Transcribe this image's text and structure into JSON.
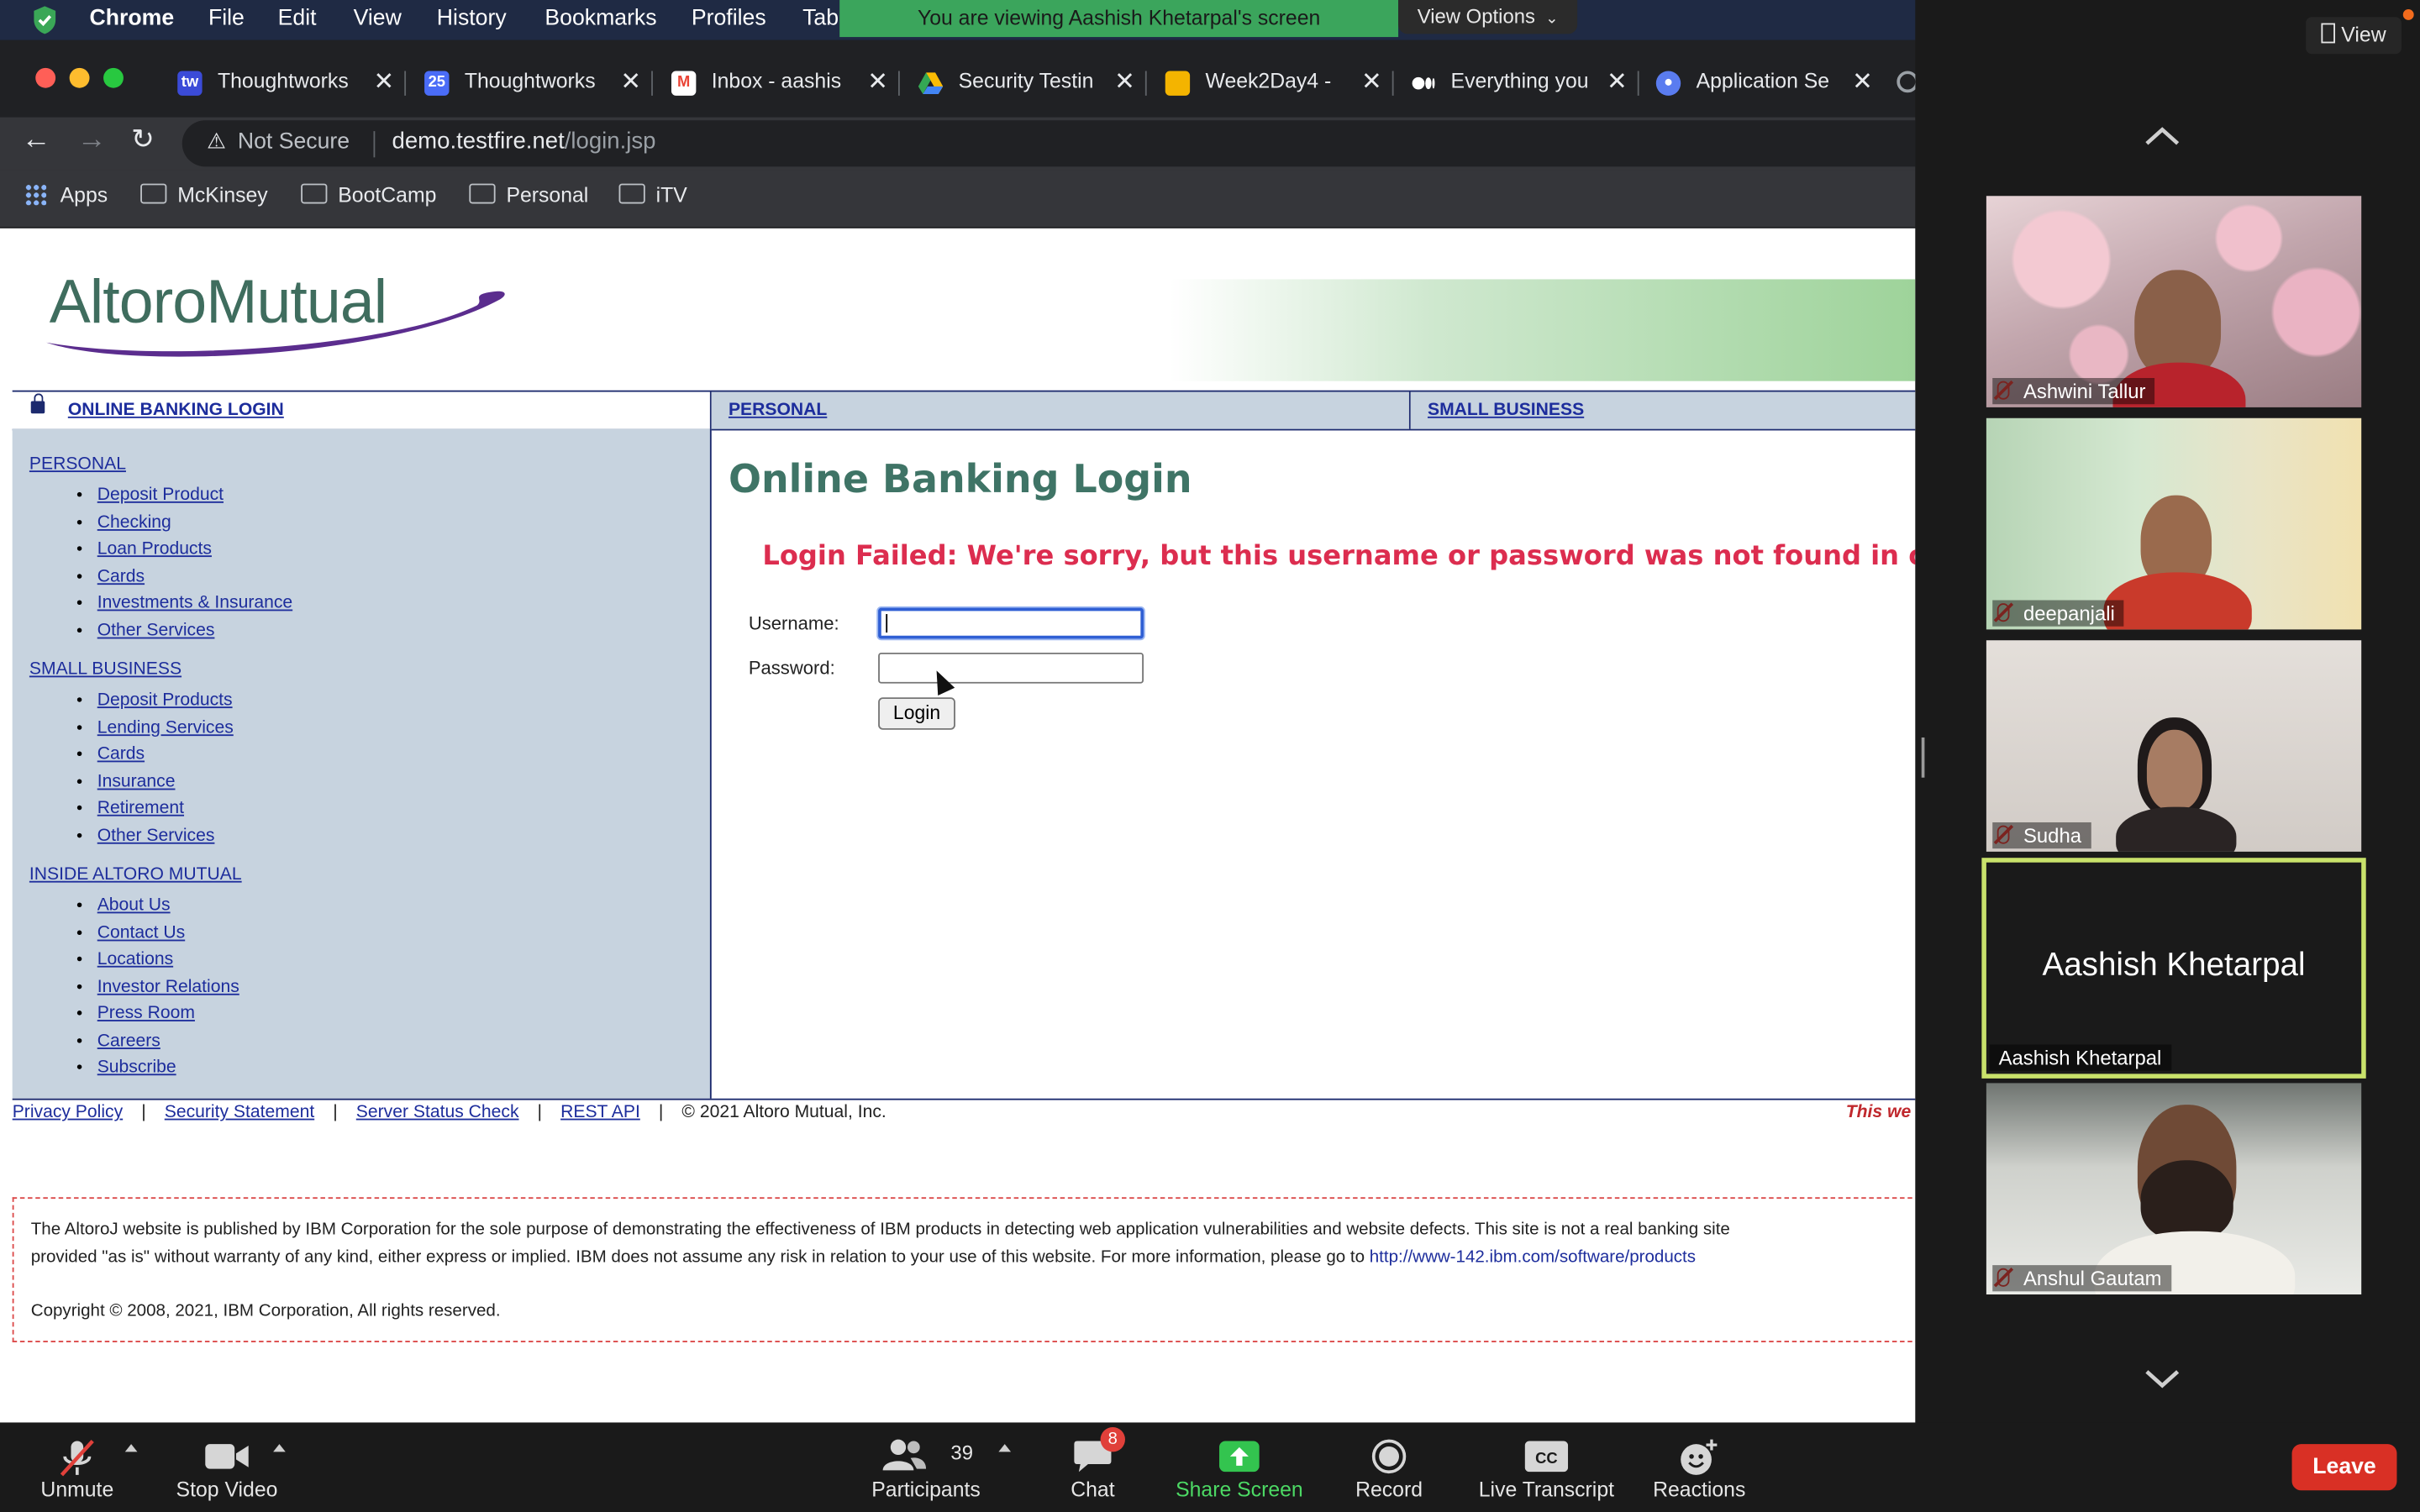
{
  "menubar": {
    "app": "Chrome",
    "items": [
      "File",
      "Edit",
      "View",
      "History",
      "Bookmarks",
      "Profiles",
      "Tab"
    ],
    "share_banner": "You are viewing Aashish Khetarpal's screen",
    "view_options": "View Options"
  },
  "tabs": [
    {
      "label": "Thoughtworks",
      "icon": "tw-icon",
      "color": "#3b4bd8"
    },
    {
      "label": "Thoughtworks",
      "icon": "calendar-icon",
      "color": "#4a6cf7"
    },
    {
      "label": "Inbox - aashis",
      "icon": "gmail-icon",
      "color": "#ea4335"
    },
    {
      "label": "Security Testin",
      "icon": "drive-icon",
      "color": "#fbbc04"
    },
    {
      "label": "Week2Day4 -",
      "icon": "slides-icon",
      "color": "#f4b400"
    },
    {
      "label": "Everything you",
      "icon": "medium-icon",
      "color": "#ffffff"
    },
    {
      "label": "Application Se",
      "icon": "app-icon",
      "color": "#5a7cf0"
    }
  ],
  "address": {
    "security": "Not Secure",
    "host": "demo.testfire.net",
    "path": "/login.jsp"
  },
  "bookmarks": [
    "Apps",
    "McKinsey",
    "BootCamp",
    "Personal",
    "iTV"
  ],
  "site": {
    "logo": "AltoroMutual",
    "nav": {
      "login": "ONLINE BANKING LOGIN",
      "personal": "PERSONAL",
      "small_business": "SMALL BUSINESS"
    },
    "sidebar": {
      "personal": {
        "title": "PERSONAL",
        "items": [
          "Deposit Product",
          "Checking",
          "Loan Products",
          "Cards",
          "Investments & Insurance",
          "Other Services"
        ]
      },
      "small_business": {
        "title": "SMALL BUSINESS",
        "items": [
          "Deposit Products",
          "Lending Services",
          "Cards",
          "Insurance",
          "Retirement",
          "Other Services"
        ]
      },
      "inside": {
        "title": "INSIDE ALTORO MUTUAL",
        "items": [
          "About Us",
          "Contact Us",
          "Locations",
          "Investor Relations",
          "Press Room",
          "Careers",
          "Subscribe"
        ]
      }
    },
    "login": {
      "heading": "Online Banking Login",
      "error": "Login Failed: We're sorry, but this username or password was not found in o",
      "username_label": "Username:",
      "password_label": "Password:",
      "username_value": "",
      "password_value": "",
      "button": "Login"
    },
    "footer": {
      "links": [
        "Privacy Policy",
        "Security Statement",
        "Server Status Check",
        "REST API"
      ],
      "copyright": "© 2021 Altoro Mutual, Inc.",
      "warning": "This we"
    },
    "disclaimer": {
      "line1": "The AltoroJ website is published by IBM Corporation for the sole purpose of demonstrating the effectiveness of IBM products in detecting web application vulnerabilities and website defects. This site is not a real banking site",
      "line2": "provided \"as is\" without warranty of any kind, either express or implied. IBM does not assume any risk in relation to your use of this website. For more information, please go to",
      "link": "http://www-142.ibm.com/software/products",
      "copyright": "Copyright © 2008, 2021, IBM Corporation, All rights reserved."
    }
  },
  "zoom": {
    "view_label": "View",
    "participants": [
      {
        "name": "Ashwini Tallur",
        "muted": true,
        "bg": "#c9b7b9"
      },
      {
        "name": "deepanjali",
        "muted": true,
        "bg": "#bcd4b0"
      },
      {
        "name": "Sudha",
        "muted": true,
        "bg": "#d9d4cf"
      },
      {
        "name": "Aashish Khetarpal",
        "muted": false,
        "bg": "#1a1a1a"
      },
      {
        "name": "Anshul Gautam",
        "muted": true,
        "bg": "#c8c8c4"
      }
    ],
    "active_speaker_big": "Aashish Khetarpal",
    "controls": {
      "unmute": "Unmute",
      "stop_video": "Stop Video",
      "participants": "Participants",
      "participants_count": "39",
      "chat": "Chat",
      "chat_badge": "8",
      "share_screen": "Share Screen",
      "record": "Record",
      "live_transcript": "Live Transcript",
      "reactions": "Reactions",
      "leave": "Leave"
    }
  }
}
